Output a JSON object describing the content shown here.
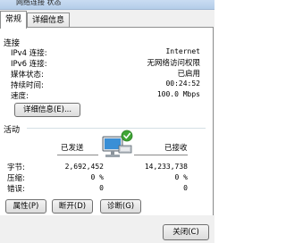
{
  "window": {
    "title": "网络连接 状态"
  },
  "tabs": [
    {
      "label": "常规"
    },
    {
      "label": "详细信息"
    }
  ],
  "connection": {
    "section_title": "连接",
    "rows": [
      {
        "label": "IPv4 连接:",
        "value": "Internet"
      },
      {
        "label": "IPv6 连接:",
        "value": "无网络访问权限"
      },
      {
        "label": "媒体状态:",
        "value": "已启用"
      },
      {
        "label": "持续时间:",
        "value": "00:24:52"
      },
      {
        "label": "速度:",
        "value": "100.0 Mbps"
      }
    ],
    "details_button": "详细信息(E)..."
  },
  "activity": {
    "section_title": "活动",
    "sent_label": "已发送",
    "received_label": "已接收",
    "rows": [
      {
        "label": "字节:",
        "sent": "2,692,452",
        "received": "14,233,738"
      },
      {
        "label": "压缩:",
        "sent": "0 %",
        "received": "0 %"
      },
      {
        "label": "错误:",
        "sent": "0",
        "received": "0"
      }
    ],
    "icon": "network-computers-icon"
  },
  "buttons": {
    "properties": "属性(P)",
    "disable": "断开(D)",
    "diagnose": "诊断(G)",
    "close": "关闭(C)"
  },
  "colors": {
    "title_bar": "#b4cde9",
    "check_badge": "#3fa535",
    "monitor_screen": "#3a8fd6"
  }
}
